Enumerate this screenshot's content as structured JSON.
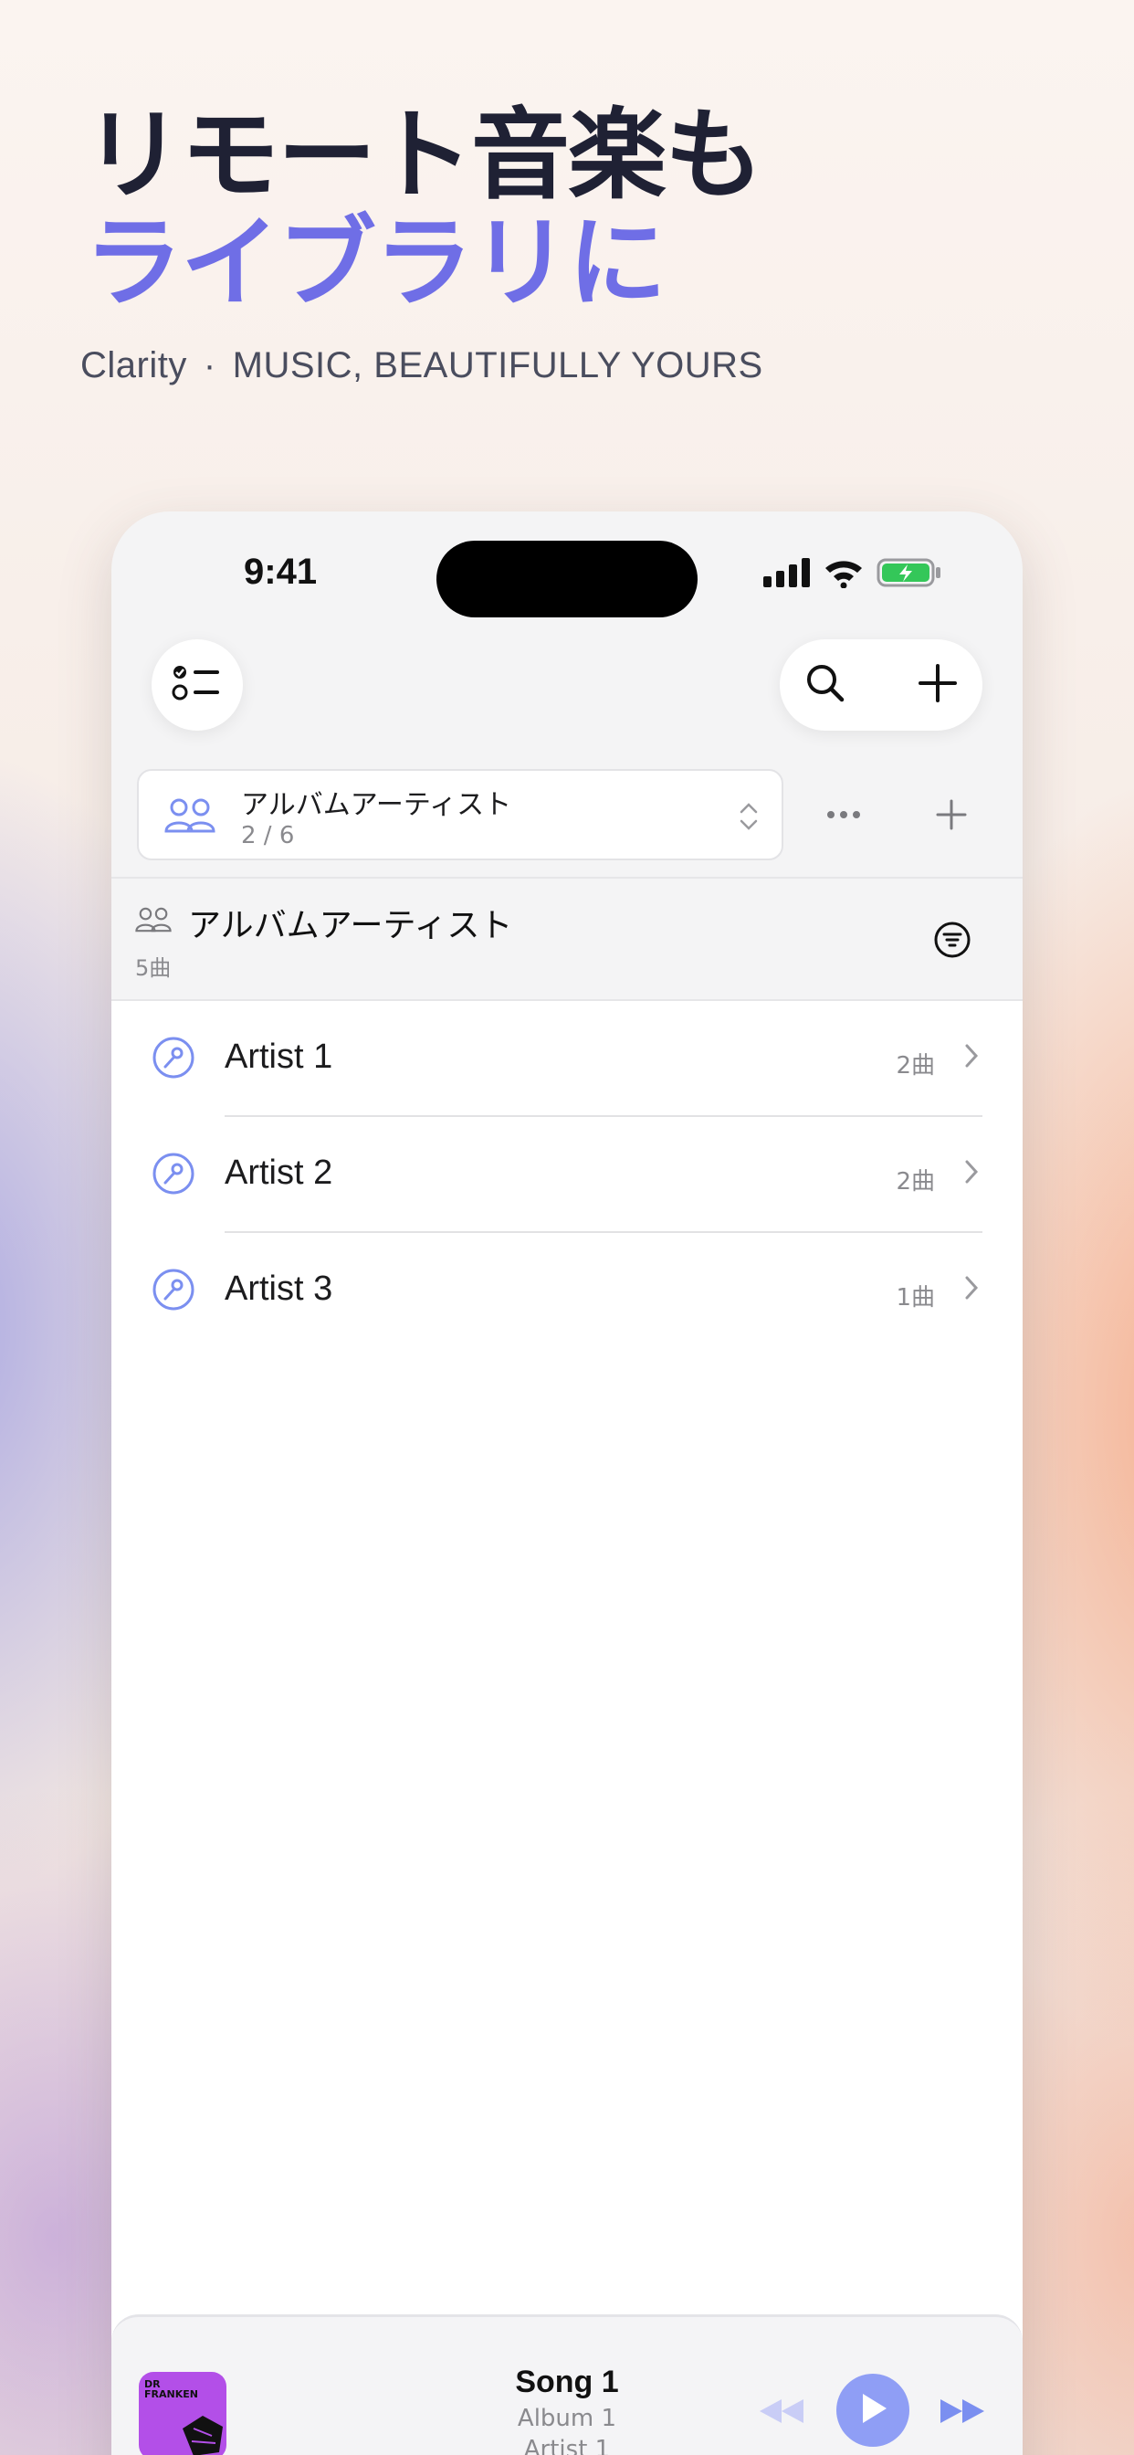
{
  "headline": {
    "line1": "リモート音楽も",
    "line2": "ライブラリに"
  },
  "tagline": {
    "brand": "Clarity",
    "separator": "·",
    "text": "MUSIC, BEAUTIFULLY YOURS"
  },
  "status_bar": {
    "time": "9:41"
  },
  "selector": {
    "title": "アルバムアーティスト",
    "subtitle": "2 / 6"
  },
  "section": {
    "title": "アルバムアーティスト",
    "count": "5曲"
  },
  "artists": [
    {
      "name": "Artist 1",
      "count": "2曲"
    },
    {
      "name": "Artist 2",
      "count": "2曲"
    },
    {
      "name": "Artist 3",
      "count": "1曲"
    }
  ],
  "now_playing": {
    "song": "Song 1",
    "album": "Album 1",
    "artist": "Artist 1",
    "artwork_text": "DR FRANKEN"
  },
  "colors": {
    "accent": "#6f6ee6",
    "icon_blue": "#7b8ff0",
    "play_button": "#8f9ef5",
    "battery": "#34c759"
  }
}
